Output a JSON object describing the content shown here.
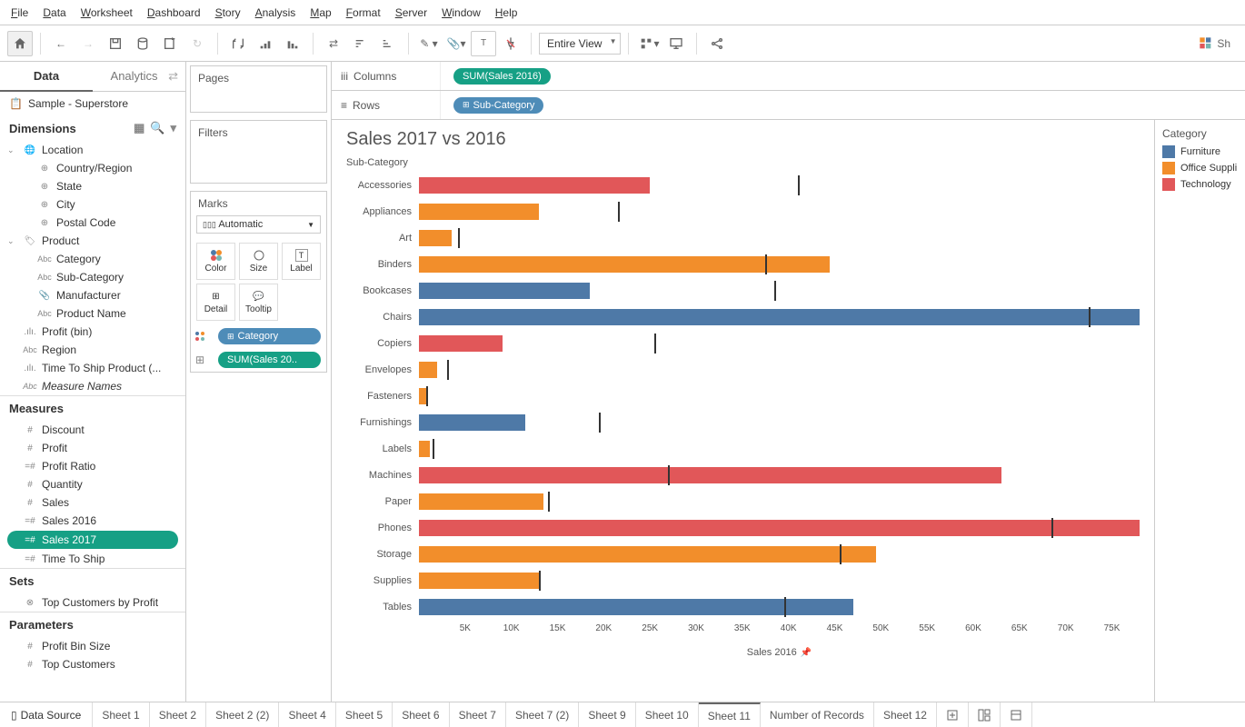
{
  "menubar": [
    "File",
    "Data",
    "Worksheet",
    "Dashboard",
    "Story",
    "Analysis",
    "Map",
    "Format",
    "Server",
    "Window",
    "Help"
  ],
  "toolbar": {
    "view_mode": "Entire View",
    "share": "Sh"
  },
  "left": {
    "tab_data": "Data",
    "tab_analytics": "Analytics",
    "datasource": "Sample - Superstore",
    "dimensions_label": "Dimensions",
    "dimensions": {
      "location": "Location",
      "country": "Country/Region",
      "state": "State",
      "city": "City",
      "postal": "Postal Code",
      "product": "Product",
      "category": "Category",
      "sub_category": "Sub-Category",
      "manufacturer": "Manufacturer",
      "product_name": "Product Name",
      "profit_bin": "Profit (bin)",
      "region": "Region",
      "time_to_ship": "Time To Ship Product (...",
      "measure_names": "Measure Names"
    },
    "measures_label": "Measures",
    "measures": {
      "discount": "Discount",
      "profit": "Profit",
      "profit_ratio": "Profit Ratio",
      "quantity": "Quantity",
      "sales": "Sales",
      "sales_2016": "Sales 2016",
      "sales_2017": "Sales 2017",
      "time_to_ship": "Time To Ship"
    },
    "sets_label": "Sets",
    "sets": {
      "top_customers": "Top Customers by Profit"
    },
    "parameters_label": "Parameters",
    "parameters": {
      "profit_bin_size": "Profit Bin Size",
      "top_customers": "Top Customers"
    }
  },
  "cards": {
    "pages": "Pages",
    "filters": "Filters",
    "marks": "Marks",
    "marks_type": "Automatic",
    "color": "Color",
    "size": "Size",
    "label": "Label",
    "detail": "Detail",
    "tooltip": "Tooltip",
    "pill_category": "Category",
    "pill_sum_sales": "SUM(Sales 20.."
  },
  "shelves": {
    "columns": "Columns",
    "rows": "Rows",
    "col_pill": "SUM(Sales 2016)",
    "row_pill": "Sub-Category"
  },
  "chart_data": {
    "type": "bar",
    "title": "Sales 2017 vs 2016",
    "subtitle": "Sub-Category",
    "xlabel": "Sales 2016",
    "xmax": 78000,
    "ticks": [
      5000,
      10000,
      15000,
      20000,
      25000,
      30000,
      35000,
      40000,
      45000,
      50000,
      55000,
      60000,
      65000,
      70000,
      75000
    ],
    "tick_labels": [
      "5K",
      "10K",
      "15K",
      "20K",
      "25K",
      "30K",
      "35K",
      "40K",
      "45K",
      "50K",
      "55K",
      "60K",
      "65K",
      "70K",
      "75K"
    ],
    "categories": [
      "Accessories",
      "Appliances",
      "Art",
      "Binders",
      "Bookcases",
      "Chairs",
      "Copiers",
      "Envelopes",
      "Fasteners",
      "Furnishings",
      "Labels",
      "Machines",
      "Paper",
      "Phones",
      "Storage",
      "Supplies",
      "Tables"
    ],
    "series": [
      {
        "name": "Sales 2016",
        "values": [
          25000,
          13000,
          3500,
          44500,
          18500,
          78000,
          9000,
          2000,
          800,
          11500,
          1200,
          63000,
          13500,
          78500,
          49500,
          13000,
          47000
        ],
        "colors": [
          "#e15759",
          "#f28e2b",
          "#f28e2b",
          "#f28e2b",
          "#4e79a7",
          "#4e79a7",
          "#e15759",
          "#f28e2b",
          "#f28e2b",
          "#4e79a7",
          "#f28e2b",
          "#e15759",
          "#f28e2b",
          "#e15759",
          "#f28e2b",
          "#f28e2b",
          "#4e79a7"
        ]
      },
      {
        "name": "Sales 2017 ref",
        "values": [
          41000,
          21500,
          4200,
          37500,
          38500,
          72500,
          25500,
          3000,
          800,
          19500,
          1500,
          27000,
          14000,
          68500,
          45500,
          13000,
          39500
        ]
      }
    ],
    "legend_title": "Category",
    "legend": [
      {
        "label": "Furniture",
        "color": "#4e79a7"
      },
      {
        "label": "Office Suppli",
        "color": "#f28e2b"
      },
      {
        "label": "Technology",
        "color": "#e15759"
      }
    ]
  },
  "bottom": {
    "data_source": "Data Source",
    "tabs": [
      "Sheet 1",
      "Sheet 2",
      "Sheet 2 (2)",
      "Sheet 4",
      "Sheet 5",
      "Sheet 6",
      "Sheet 7",
      "Sheet 7 (2)",
      "Sheet 9",
      "Sheet 10",
      "Sheet 11",
      "Number of Records",
      "Sheet 12"
    ],
    "active": 10
  }
}
